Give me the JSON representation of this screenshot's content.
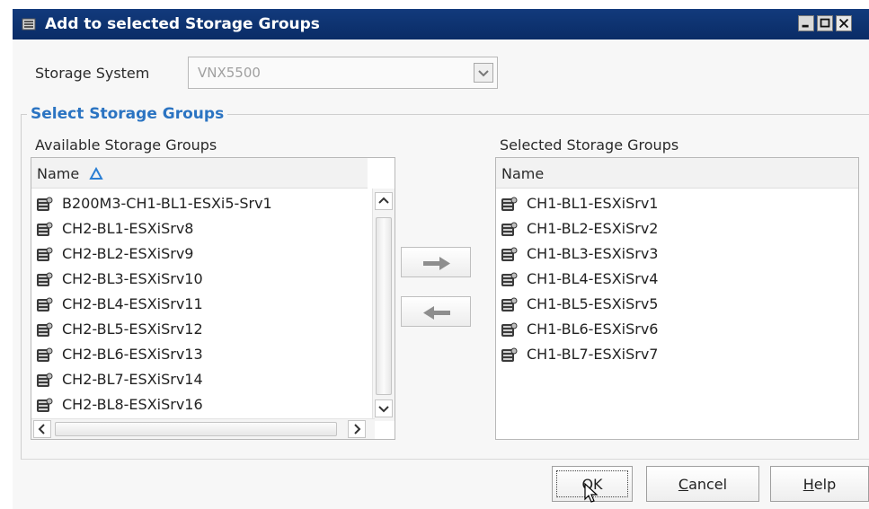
{
  "window": {
    "title": "Add to selected Storage Groups",
    "title_icon": "storage-group-icon"
  },
  "storage_system": {
    "label": "Storage System",
    "value": "VNX5500"
  },
  "select_groups": {
    "legend": "Select Storage Groups",
    "available": {
      "label": "Available Storage Groups",
      "column_header": "Name",
      "sort_icon": "sort-ascending-icon",
      "items": [
        "B200M3-CH1-BL1-ESXi5-Srv1",
        "CH2-BL1-ESXiSrv8",
        "CH2-BL2-ESXiSrv9",
        "CH2-BL3-ESXiSrv10",
        "CH2-BL4-ESXiSrv11",
        "CH2-BL5-ESXiSrv12",
        "CH2-BL6-ESXiSrv13",
        "CH2-BL7-ESXiSrv14",
        "CH2-BL8-ESXiSrv16"
      ]
    },
    "selected": {
      "label": "Selected Storage Groups",
      "column_header": "Name",
      "items": [
        "CH1-BL1-ESXiSrv1",
        "CH1-BL2-ESXiSrv2",
        "CH1-BL3-ESXiSrv3",
        "CH1-BL4-ESXiSrv4",
        "CH1-BL5-ESXiSrv5",
        "CH1-BL6-ESXiSrv6",
        "CH1-BL7-ESXiSrv7"
      ]
    },
    "add_icon": "arrow-right-icon",
    "remove_icon": "arrow-left-icon"
  },
  "buttons": {
    "ok_label": "OK",
    "cancel_first": "C",
    "cancel_rest": "ancel",
    "help_first": "H",
    "help_rest": "elp"
  },
  "colors": {
    "title_bar": "#0a2c66",
    "legend_text": "#2b74c2",
    "sort_icon": "#2b7fd4"
  }
}
